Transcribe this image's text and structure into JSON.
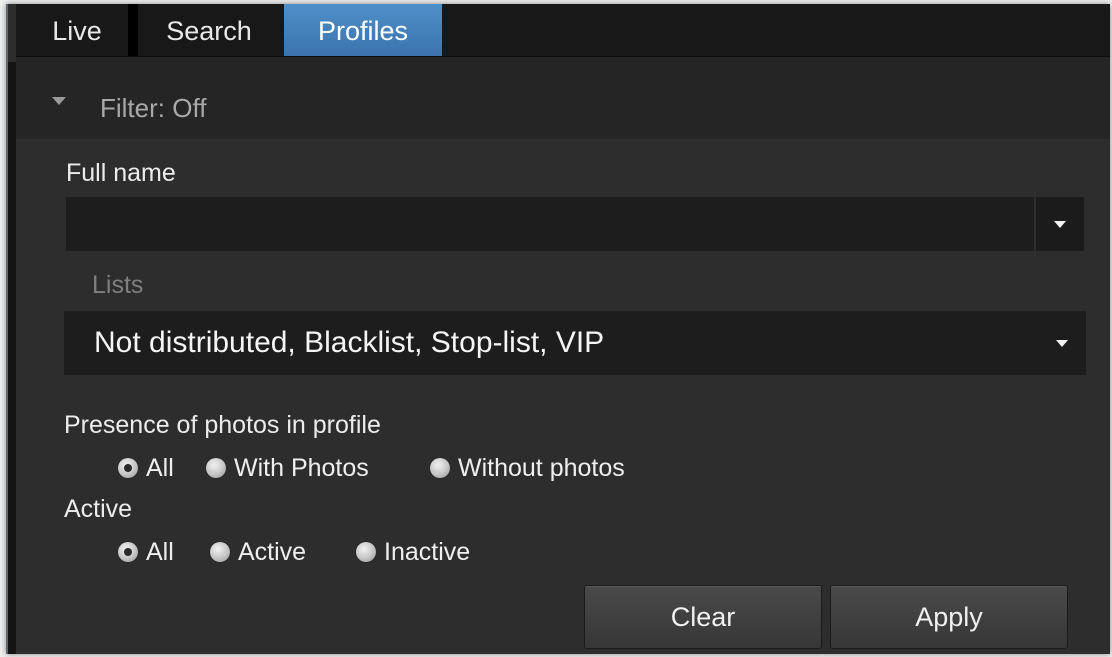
{
  "tabs": [
    {
      "label": "Live"
    },
    {
      "label": "Search"
    },
    {
      "label": "Profiles"
    }
  ],
  "filter": {
    "label": "Filter: Off"
  },
  "full_name": {
    "label": "Full name",
    "value": ""
  },
  "lists": {
    "label": "Lists",
    "value": "Not distributed, Blacklist, Stop-list, VIP"
  },
  "presence": {
    "label": "Presence of photos in profile",
    "options": [
      "All",
      "With Photos",
      "Without photos"
    ],
    "selected": "All"
  },
  "active": {
    "label": "Active",
    "options": [
      "All",
      "Active",
      "Inactive"
    ],
    "selected": "All"
  },
  "buttons": {
    "clear": "Clear",
    "apply": "Apply"
  },
  "colors": {
    "active_tab": "#4a88c5",
    "panel_bg": "#2d2d2d",
    "field_bg": "#1d1d1d"
  }
}
